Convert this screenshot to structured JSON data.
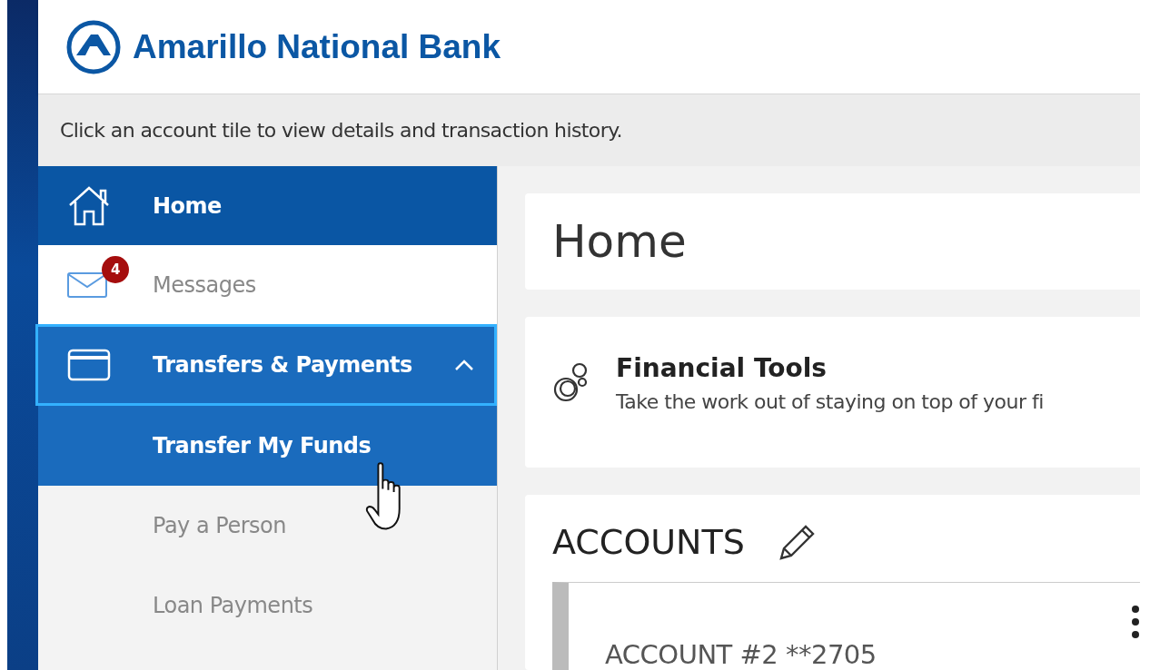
{
  "header": {
    "brand": "Amarillo National Bank"
  },
  "hint": "Click an account tile to view details and transaction history.",
  "sidebar": {
    "items": [
      {
        "label": "Home",
        "kind": "home",
        "selected": true
      },
      {
        "label": "Messages",
        "kind": "mail",
        "selected": false,
        "badge": "4"
      },
      {
        "label": "Transfers & Payments",
        "kind": "card",
        "selected": false,
        "expanded": true,
        "focused": true,
        "children": [
          {
            "label": "Transfer My Funds",
            "selected": true
          },
          {
            "label": "Pay a Person",
            "selected": false
          },
          {
            "label": "Loan Payments",
            "selected": false
          }
        ]
      }
    ]
  },
  "page_title": "Home",
  "financial_tools": {
    "title": "Financial Tools",
    "description": "Take the work out of staying on top of your fi"
  },
  "accounts": {
    "title": "ACCOUNTS",
    "tiles": [
      {
        "name": "ACCOUNT #2 **2705"
      }
    ]
  }
}
